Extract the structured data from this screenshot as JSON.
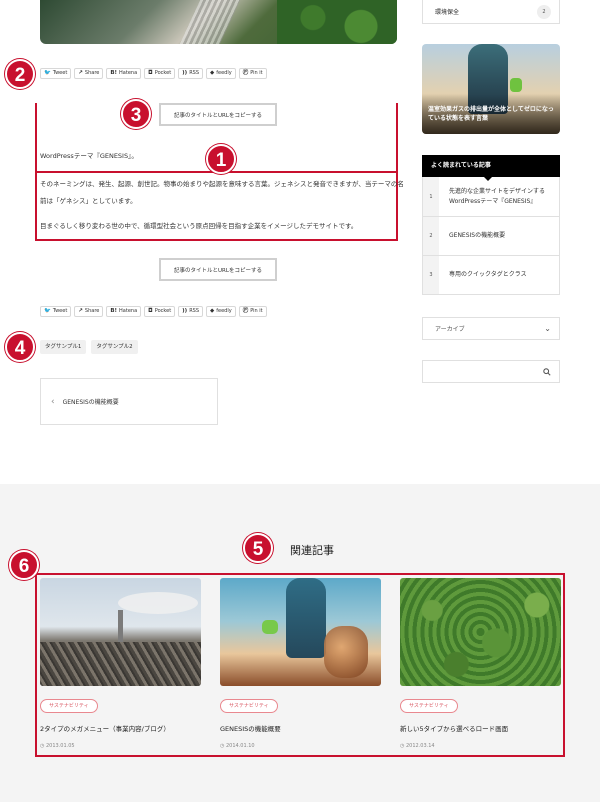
{
  "share": {
    "buttons": [
      {
        "icon": "twitter-icon",
        "label": "Tweet"
      },
      {
        "icon": "share-icon",
        "label": "Share"
      },
      {
        "icon": "hatena-icon",
        "label": "Hatena"
      },
      {
        "icon": "pocket-icon",
        "label": "Pocket"
      },
      {
        "icon": "rss-icon",
        "label": "RSS"
      },
      {
        "icon": "feedly-icon",
        "label": "feedly"
      },
      {
        "icon": "pinterest-icon",
        "label": "Pin it"
      }
    ]
  },
  "markers": [
    "2",
    "3",
    "1",
    "4",
    "5",
    "6"
  ],
  "article": {
    "copy_button": "記事のタイトルとURLをコピーする",
    "paragraphs": [
      "WordPressテーマ『GENESIS』。",
      "そのネーミングは、発生、起源、創世記。物事の始まりや起源を意味する言葉。ジェネシスと発音できますが、当テーマの名",
      "前は「ゲネシス」としています。",
      "目まぐるしく移り変わる世の中で、循環型社会という原点回帰を目指す企業をイメージしたデモサイトです。"
    ],
    "tags": [
      "タグサンプル1",
      "タグサンプル2"
    ],
    "prev_post": "GENESISの機能概要"
  },
  "sidebar": {
    "category": {
      "label": "環境保全",
      "count": "2"
    },
    "feature_caption": "温室効果ガスの排出量が全体としてゼロになっている状態を表す言葉",
    "popular_heading": "よく読まれている記事",
    "popular": [
      {
        "num": "1",
        "title": "先進的な企業サイトをデザインするWordPressテーマ『GENESIS』"
      },
      {
        "num": "2",
        "title": "GENESISの機能概要"
      },
      {
        "num": "3",
        "title": "専用のクイックタグとクラス"
      }
    ],
    "archive_label": "アーカイブ"
  },
  "related": {
    "heading": "関連記事",
    "cards": [
      {
        "badge": "サステナビリティ",
        "title": "2タイプのメガメニュー（事業内容/ブログ）",
        "date": "2013.01.05"
      },
      {
        "badge": "サステナビリティ",
        "title": "GENESISの機能概要",
        "date": "2014.01.10"
      },
      {
        "badge": "サステナビリティ",
        "title": "新しい5タイプから選べるロード画面",
        "date": "2012.03.14"
      }
    ]
  },
  "colors": {
    "annotation_red": "#c8102e",
    "badge_pink": "#d9535e"
  }
}
